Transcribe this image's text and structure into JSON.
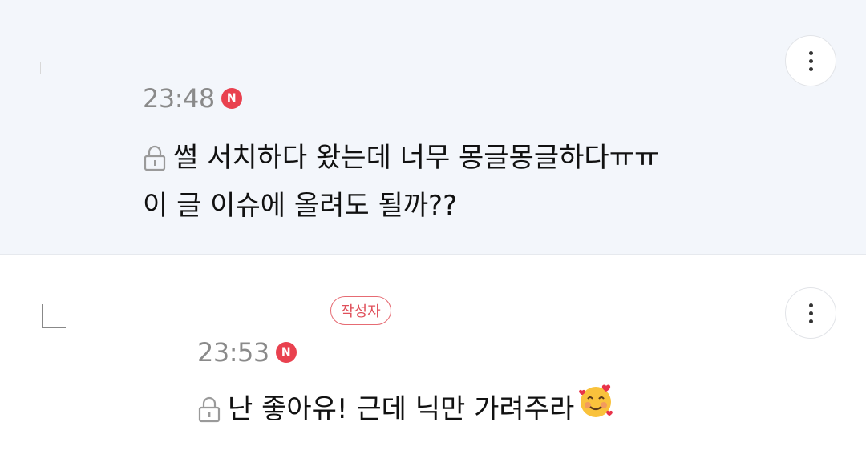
{
  "comments": [
    {
      "time": "23:48",
      "new_badge": "N",
      "lines": [
        "썰 서치하다 왔는데 너무 몽글몽글하다ㅠㅠ",
        "이 글 이슈에 올려도 될까??"
      ],
      "more_icon": "more-vertical-icon",
      "lock_icon": "lock-icon"
    },
    {
      "time": "23:53",
      "new_badge": "N",
      "author_label": "작성자",
      "lines": [
        "난 좋아유! 근데 닉만 가려주라"
      ],
      "emoji": "smiling-face-with-hearts",
      "more_icon": "more-vertical-icon",
      "lock_icon": "lock-icon",
      "reply_icon": "reply-corner-icon"
    }
  ],
  "colors": {
    "highlight_bg": "#f3f6fb",
    "new_badge": "#e9414f",
    "author_badge": "#e0505b",
    "time_text": "#8a8a8a"
  }
}
